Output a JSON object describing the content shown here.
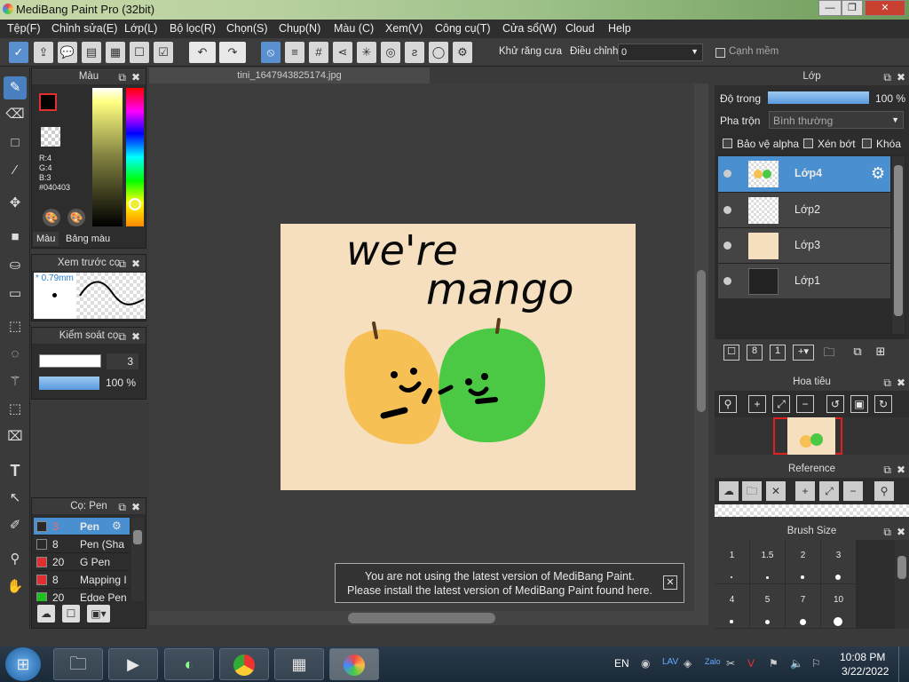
{
  "app": {
    "title": "MediBang Paint Pro (32bit)",
    "min": "—",
    "max": "❐",
    "close": "✕"
  },
  "menu": [
    "Tệp(F)",
    "Chỉnh sửa(E)",
    "Lớp(L)",
    "Bộ lọc(R)",
    "Chọn(S)",
    "Chụp(N)",
    "Màu (C)",
    "Xem(V)",
    "Công cụ(T)",
    "Cửa sổ(W)",
    "Cloud",
    "Help"
  ],
  "toolbar": {
    "antialias": "Khử răng cưa",
    "adjust": "Điều chỉnh",
    "adjust_value": "0",
    "soft_edge": "Cạnh mềm"
  },
  "color_panel": {
    "title": "Màu",
    "r": "R:4",
    "g": "G:4",
    "b": "B:3",
    "hex": "#040403",
    "tab1": "Màu",
    "tab2": "Bảng màu"
  },
  "preview_panel": {
    "title": "Xem trước cọ",
    "size": "* 0.79mm"
  },
  "brush_control": {
    "title": "Kiểm soát cọ",
    "size": "3",
    "opacity": "100 %"
  },
  "brush_panel": {
    "title": "Cọ: Pen",
    "items": [
      {
        "size": "3",
        "name": "Pen",
        "color": "#2a2a2a"
      },
      {
        "size": "8",
        "name": "Pen (Sha",
        "color": "#2a2a2a"
      },
      {
        "size": "20",
        "name": "G Pen",
        "color": "#e03030"
      },
      {
        "size": "8",
        "name": "Mapping I",
        "color": "#e03030"
      },
      {
        "size": "20",
        "name": "Edge Pen",
        "color": "#20c020"
      }
    ]
  },
  "canvas": {
    "tab": "tini_1647943825174.jpg",
    "text1": "we're",
    "text2": "mango",
    "bg": "#f5dfbe"
  },
  "notice": {
    "line1": "You are not using the latest version of MediBang Paint.",
    "line2": "Please install the latest version of MediBang Paint found here.",
    "close": "✕"
  },
  "layers": {
    "title": "Lớp",
    "opacity_label": "Độ trong",
    "opacity_value": "100 %",
    "blend_label": "Pha trộn",
    "blend_value": "Bình thường",
    "alpha": "Bảo vệ alpha",
    "clip": "Xén bớt",
    "lock": "Khóa",
    "items": [
      {
        "name": "Lớp4"
      },
      {
        "name": "Lớp2"
      },
      {
        "name": "Lớp3"
      },
      {
        "name": "Lớp1"
      }
    ]
  },
  "navigator": {
    "title": "Hoa tiêu"
  },
  "reference": {
    "title": "Reference"
  },
  "brush_size": {
    "title": "Brush Size",
    "row1": [
      "1",
      "1.5",
      "2",
      "3"
    ],
    "row2": [
      "4",
      "5",
      "7",
      "10"
    ]
  },
  "taskbar": {
    "lang": "EN",
    "time": "10:08 PM",
    "date": "3/22/2022"
  },
  "colors": {
    "accent": "#4a7fc0",
    "fg": "#040403",
    "bg_secondary": "#b03040"
  }
}
